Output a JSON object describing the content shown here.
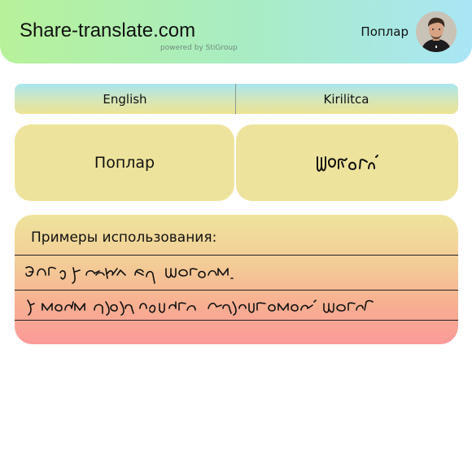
{
  "header": {
    "brand": "Share-translate.com",
    "powered_by": "powered by StiGroup",
    "username": "Поплар"
  },
  "languages": {
    "source": "English",
    "target": "Kirilitca"
  },
  "translation": {
    "source_text": "Поплар",
    "target_text": "ɯɪɤɾɤɾɑɪ"
  },
  "examples": {
    "title": "Примеры использования:"
  },
  "icons": {
    "avatar": "user-avatar-photo"
  }
}
